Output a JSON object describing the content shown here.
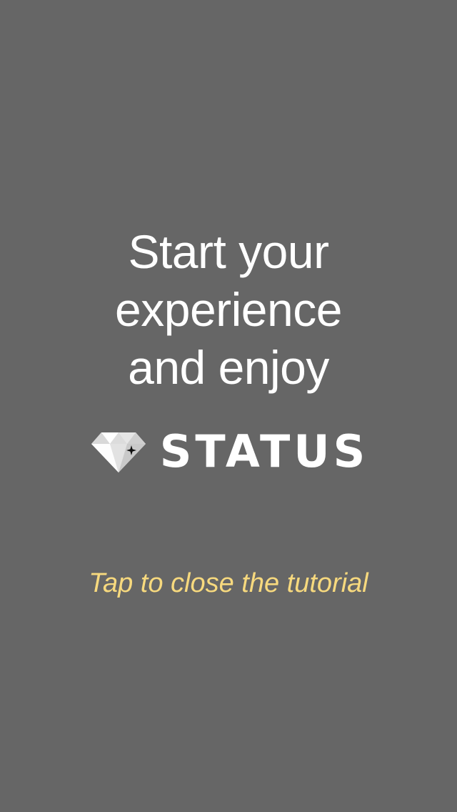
{
  "tutorial": {
    "headline_lines": [
      "Start your",
      "experience",
      "and enjoy"
    ],
    "brand_name": "STATUS",
    "brand_icon": "diamond-icon",
    "close_hint": "Tap to close the tutorial"
  },
  "colors": {
    "background": "#666666",
    "headline": "#ffffff",
    "hint": "#f7d97e"
  }
}
